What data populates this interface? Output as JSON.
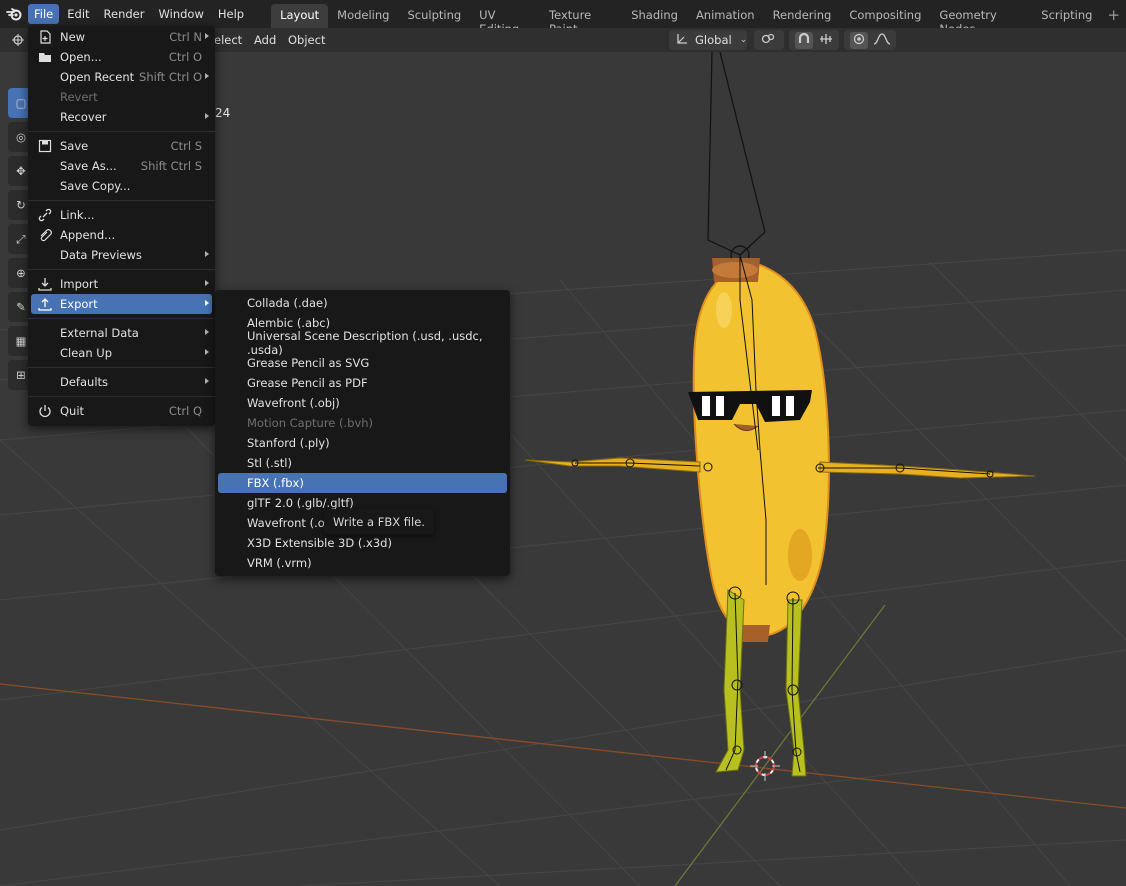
{
  "top_menu": [
    "File",
    "Edit",
    "Render",
    "Window",
    "Help"
  ],
  "workspaces": [
    "Layout",
    "Modeling",
    "Sculpting",
    "UV Editing",
    "Texture Paint",
    "Shading",
    "Animation",
    "Rendering",
    "Compositing",
    "Geometry Nodes",
    "Scripting"
  ],
  "viewport_header": {
    "menus": [
      "elect",
      "Add",
      "Object"
    ],
    "orientation": "Global"
  },
  "partial_overlay_text": "24",
  "file_menu": [
    {
      "label": "New",
      "shortcut": "Ctrl N",
      "icon": "new-file-icon",
      "submenu": true
    },
    {
      "label": "Open...",
      "shortcut": "Ctrl O",
      "icon": "folder-icon"
    },
    {
      "label": "Open Recent",
      "shortcut": "Shift Ctrl O",
      "submenu": true
    },
    {
      "label": "Revert",
      "disabled": true
    },
    {
      "label": "Recover",
      "submenu": true
    },
    {
      "separator": true
    },
    {
      "label": "Save",
      "shortcut": "Ctrl S",
      "icon": "save-icon"
    },
    {
      "label": "Save As...",
      "shortcut": "Shift Ctrl S"
    },
    {
      "label": "Save Copy..."
    },
    {
      "separator": true
    },
    {
      "label": "Link...",
      "icon": "link-icon"
    },
    {
      "label": "Append...",
      "icon": "append-icon"
    },
    {
      "label": "Data Previews",
      "submenu": true
    },
    {
      "separator": true
    },
    {
      "label": "Import",
      "icon": "import-icon",
      "submenu": true
    },
    {
      "label": "Export",
      "icon": "export-icon",
      "submenu": true,
      "highlight": true
    },
    {
      "separator": true
    },
    {
      "label": "External Data",
      "submenu": true
    },
    {
      "label": "Clean Up",
      "submenu": true
    },
    {
      "separator": true
    },
    {
      "label": "Defaults",
      "submenu": true
    },
    {
      "separator": true
    },
    {
      "label": "Quit",
      "shortcut": "Ctrl Q",
      "icon": "power-icon"
    }
  ],
  "export_menu": [
    {
      "label": "Collada (.dae)"
    },
    {
      "label": "Alembic (.abc)"
    },
    {
      "label": "Universal Scene Description (.usd, .usdc, .usda)"
    },
    {
      "label": "Grease Pencil as SVG"
    },
    {
      "label": "Grease Pencil as PDF"
    },
    {
      "label": "Wavefront (.obj)"
    },
    {
      "label": "Motion Capture (.bvh)",
      "disabled": true
    },
    {
      "label": "Stanford (.ply)"
    },
    {
      "label": "Stl (.stl)"
    },
    {
      "label": "FBX (.fbx)",
      "highlight": true
    },
    {
      "label": "glTF 2.0 (.glb/.gltf)"
    },
    {
      "label": "Wavefront (.obj)"
    },
    {
      "label": "X3D Extensible 3D (.x3d)"
    },
    {
      "label": "VRM (.vrm)"
    }
  ],
  "tooltip": "Write a FBX file.",
  "colors": {
    "accent": "#4772b3",
    "menu_bg": "#181818",
    "viewport_bg": "#393939"
  }
}
